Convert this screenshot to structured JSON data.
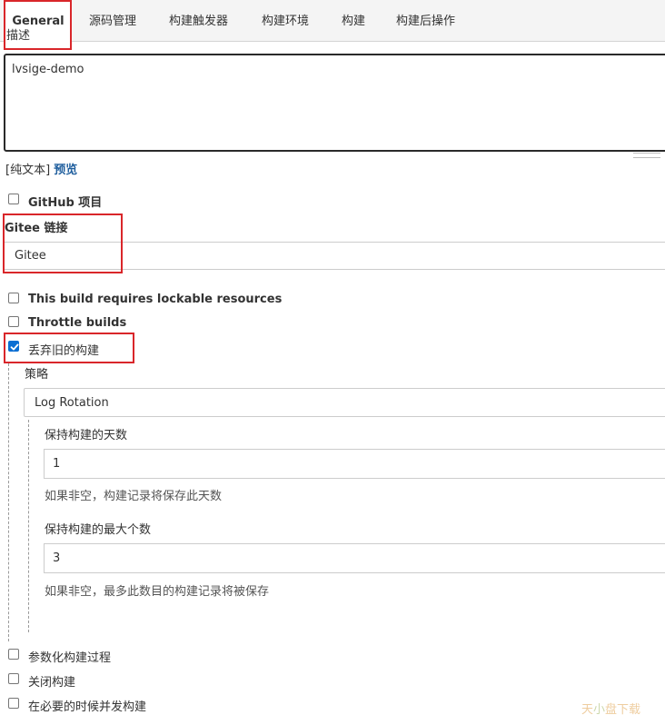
{
  "tabs": [
    {
      "label": "General",
      "active": true
    },
    {
      "label": "源码管理"
    },
    {
      "label": "构建触发器"
    },
    {
      "label": "构建环境"
    },
    {
      "label": "构建"
    },
    {
      "label": "构建后操作"
    }
  ],
  "description": {
    "label": "描述",
    "value": "lvsige-demo",
    "format_text": "[纯文本]",
    "preview_link": "预览"
  },
  "options": {
    "github_project": "GitHub 项目",
    "gitee_link_label": "Gitee 链接",
    "gitee_value": "Gitee",
    "lockable": "This build requires lockable resources",
    "throttle": "Throttle builds",
    "discard_old": "丢弃旧的构建",
    "parameterized": "参数化构建过程",
    "disable_build": "关闭构建",
    "concurrent": "在必要的时候并发构建"
  },
  "discard": {
    "strategy_label": "策略",
    "strategy_value": "Log Rotation",
    "days_label": "保持构建的天数",
    "days_value": "1",
    "days_help": "如果非空，构建记录将保存此天数",
    "max_label": "保持构建的最大个数",
    "max_value": "3",
    "max_help": "如果非空，最多此数目的构建记录将被保存"
  },
  "watermark": {
    "left": "天",
    "mid": "小",
    "right": "盘下载"
  },
  "colors": {
    "highlight": "#d9262a",
    "link": "#205f9e",
    "checkbox_checked": "#0b6fd3"
  }
}
